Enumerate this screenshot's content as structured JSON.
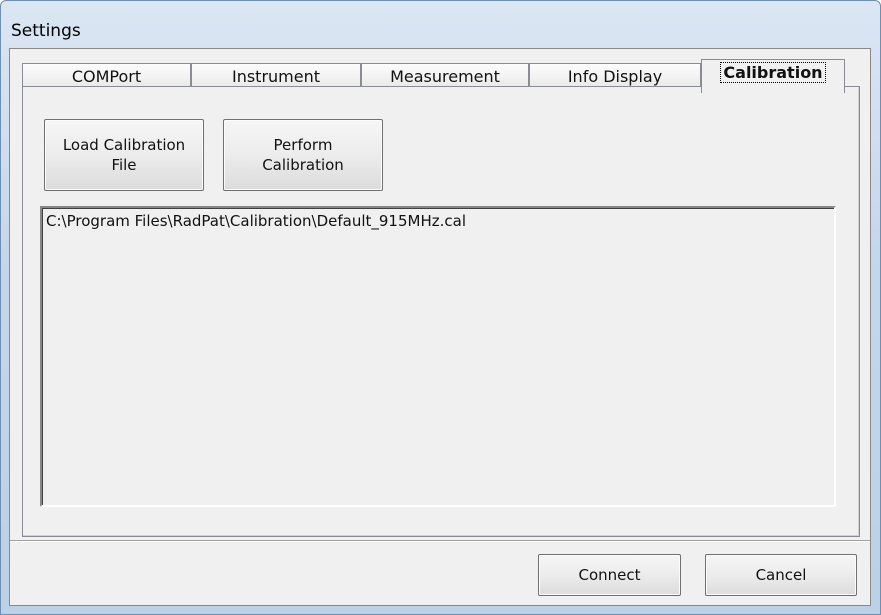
{
  "window": {
    "title": "Settings"
  },
  "tabs": [
    {
      "label": "COMPort",
      "active": false
    },
    {
      "label": "Instrument",
      "active": false
    },
    {
      "label": "Measurement",
      "active": false
    },
    {
      "label": "Info Display",
      "active": false
    },
    {
      "label": "Calibration",
      "active": true
    }
  ],
  "calibration": {
    "load_button_label": "Load Calibration\nFile",
    "perform_button_label": "Perform\nCalibration",
    "files": [
      "C:\\Program Files\\RadPat\\Calibration\\Default_915MHz.cal"
    ]
  },
  "footer": {
    "connect_label": "Connect",
    "cancel_label": "Cancel"
  }
}
